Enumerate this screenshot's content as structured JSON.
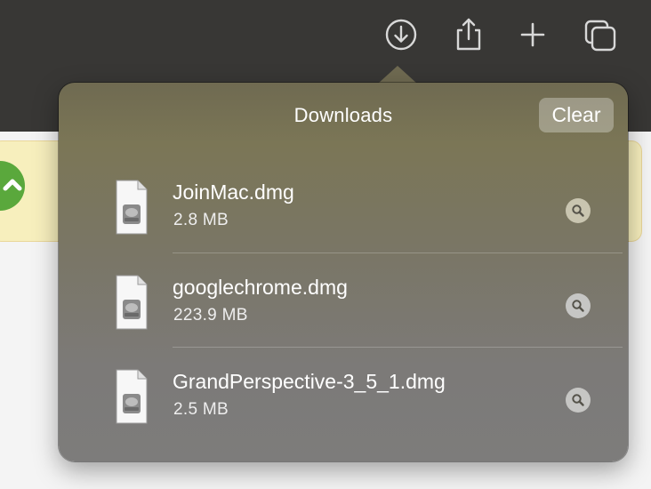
{
  "toolbar": {
    "buttons": [
      {
        "icon": "arrow-down-circle-icon"
      },
      {
        "icon": "share-icon"
      },
      {
        "icon": "plus-icon"
      },
      {
        "icon": "tabs-overview-icon"
      }
    ]
  },
  "background": {
    "banner_color": "#f7efbd",
    "banner_icon_color": "#5aa83c"
  },
  "downloads": {
    "title": "Downloads",
    "clear_label": "Clear",
    "items": [
      {
        "name": "JoinMac.dmg",
        "size": "2.8 MB",
        "icon": "disk-image-file-icon"
      },
      {
        "name": "googlechrome.dmg",
        "size": "223.9 MB",
        "icon": "disk-image-file-icon"
      },
      {
        "name": "GrandPerspective-3_5_1.dmg",
        "size": "2.5 MB",
        "icon": "disk-image-file-icon"
      }
    ]
  },
  "colors": {
    "toolbar_bg": "#383735",
    "popover_top": "#6f6a51",
    "popover_bottom": "#7d7c7b",
    "text": "#ffffff"
  }
}
